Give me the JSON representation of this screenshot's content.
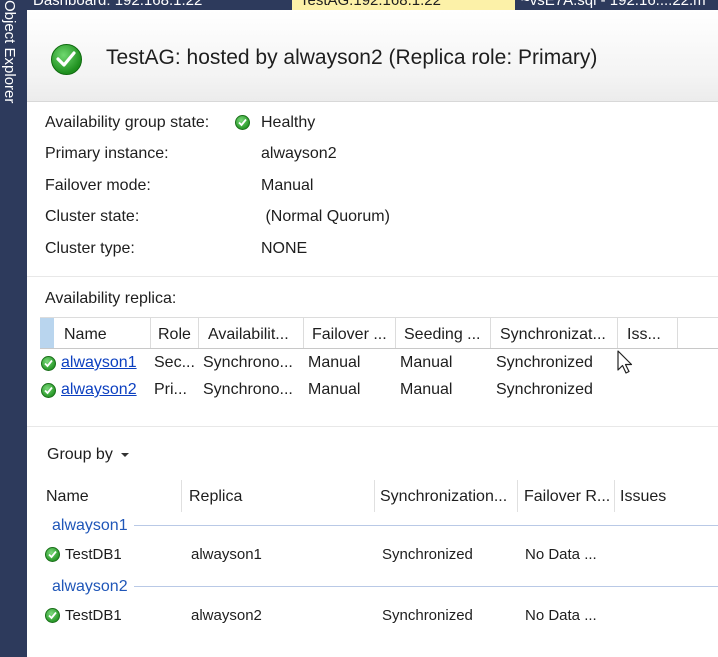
{
  "sidebar": {
    "label": "Object Explorer"
  },
  "tabs": [
    {
      "label": "Dashboard: 192.168.1.22"
    },
    {
      "label": "TestAG:192.168.1.22"
    },
    {
      "label": "~vsE7A.sql - 192.16....22.m"
    }
  ],
  "header": {
    "title": "TestAG: hosted by alwayson2 (Replica role: Primary)"
  },
  "properties": {
    "ag_state_label": "Availability group state:",
    "ag_state_value": "Healthy",
    "primary_label": "Primary instance:",
    "primary_value": "alwayson2",
    "failover_label": "Failover mode:",
    "failover_value": "Manual",
    "cluster_state_label": "Cluster state:",
    "cluster_state_value": " (Normal Quorum)",
    "cluster_type_label": "Cluster type:",
    "cluster_type_value": "NONE"
  },
  "replica_section": {
    "title": "Availability replica:",
    "columns": [
      "Name",
      "Role",
      "Availabilit...",
      "Failover ...",
      "Seeding ...",
      "Synchronizat...",
      "Iss..."
    ],
    "rows": [
      {
        "name": "alwayson1",
        "role": "Sec...",
        "availability": "Synchrono...",
        "failover": "Manual",
        "seeding": "Manual",
        "sync": "Synchronized",
        "issues": ""
      },
      {
        "name": "alwayson2",
        "role": "Pri...",
        "availability": "Synchrono...",
        "failover": "Manual",
        "seeding": "Manual",
        "sync": "Synchronized",
        "issues": ""
      }
    ]
  },
  "database_section": {
    "group_by_label": "Group by",
    "columns": [
      "Name",
      "Replica",
      "Synchronization...",
      "Failover R...",
      "Issues"
    ],
    "groups": [
      {
        "name": "alwayson1",
        "rows": [
          {
            "db": "TestDB1",
            "replica": "alwayson1",
            "sync": "Synchronized",
            "failover": "No Data ...",
            "issues": ""
          }
        ]
      },
      {
        "name": "alwayson2",
        "rows": [
          {
            "db": "TestDB1",
            "replica": "alwayson2",
            "sync": "Synchronized",
            "failover": "No Data ...",
            "issues": ""
          }
        ]
      }
    ]
  },
  "colors": {
    "accent": "#2d3a5c",
    "active_tab": "#fcf1a8",
    "link": "#0b3fc0",
    "group": "#1f56b8",
    "healthy": "#2a9a2a"
  },
  "icons": [
    "healthy-check-icon",
    "mouse-cursor-icon",
    "dropdown-caret-icon"
  ]
}
